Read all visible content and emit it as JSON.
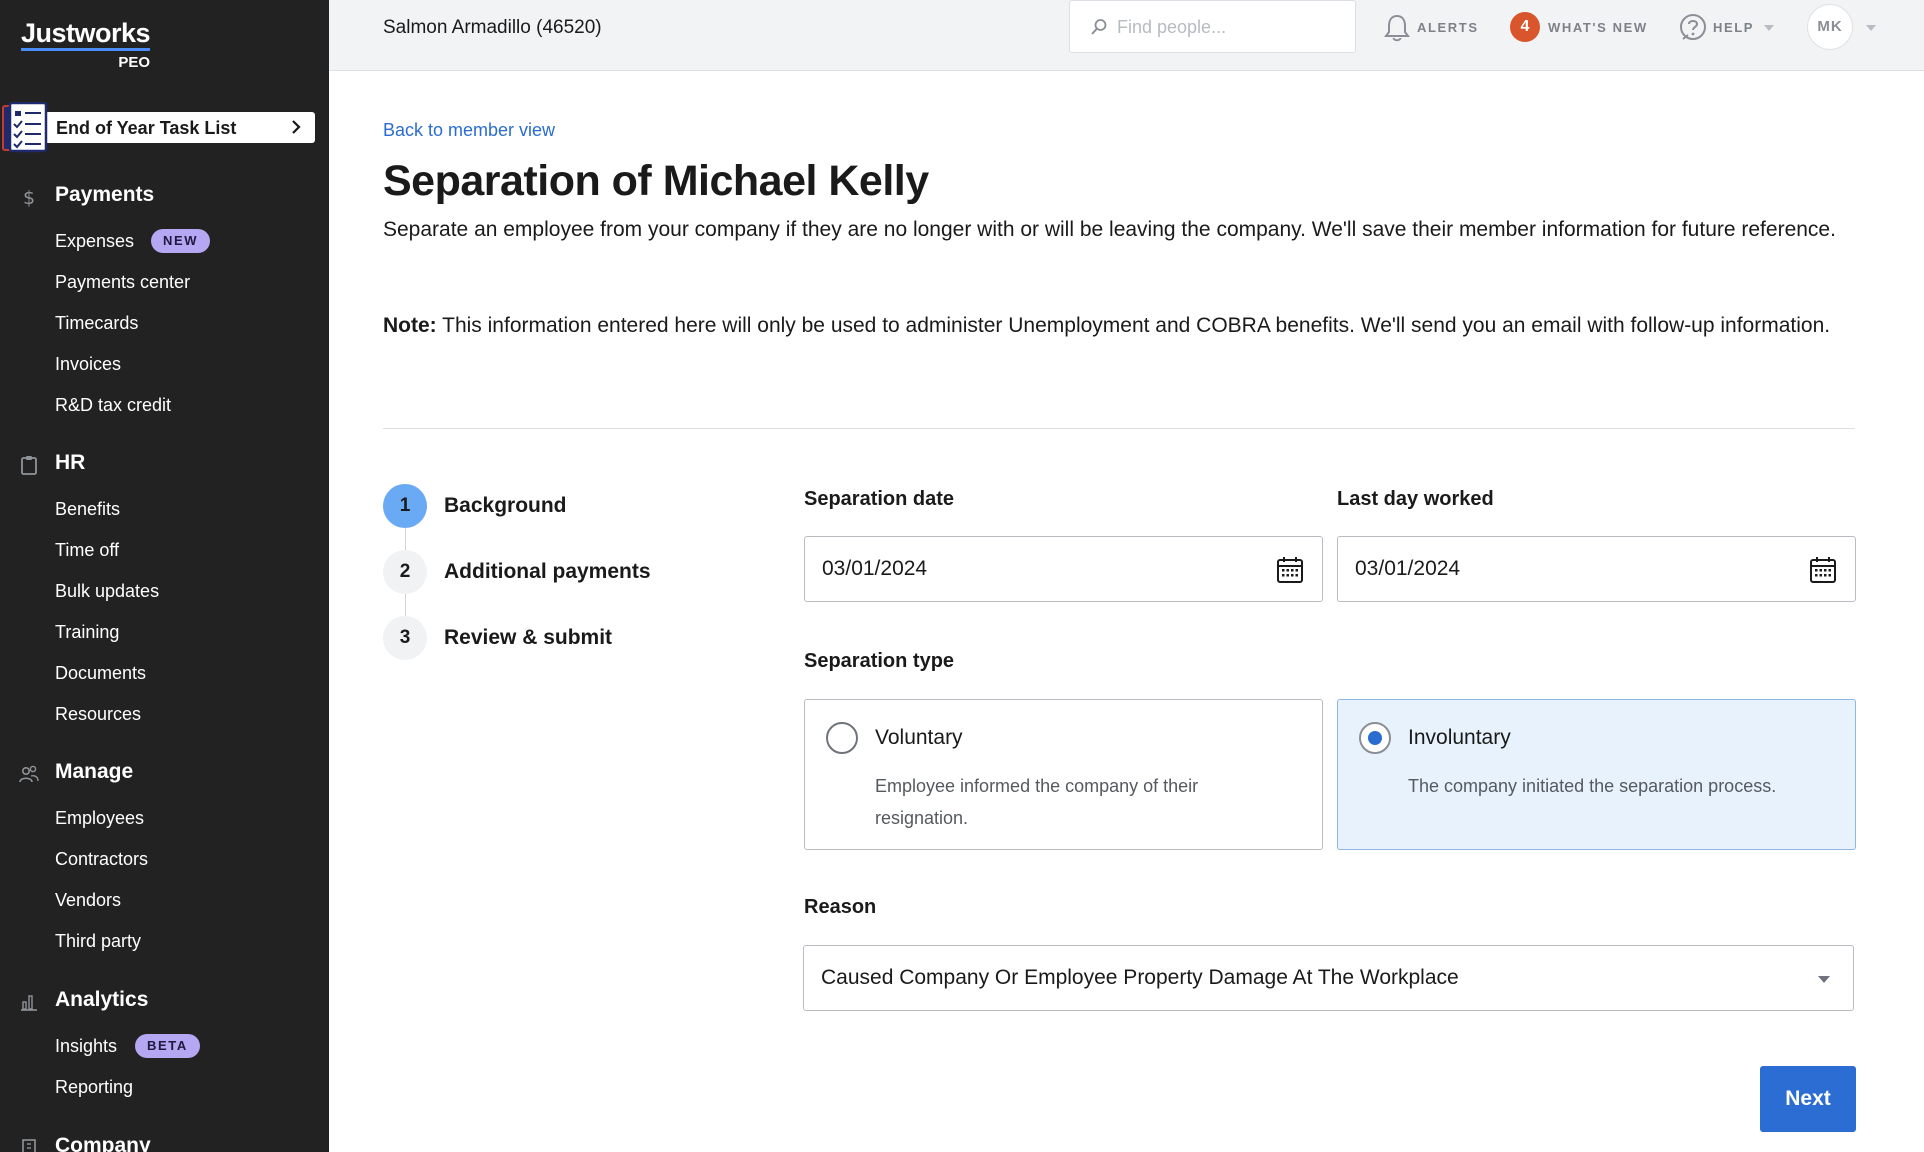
{
  "brand": {
    "logo_word": "Justworks",
    "logo_sub": "PEO"
  },
  "sidebar": {
    "task_card": {
      "label": "End of Year Task List"
    },
    "sections": [
      {
        "icon": "dollar-icon",
        "label": "Payments",
        "items": [
          {
            "label": "Expenses",
            "badge": "NEW"
          },
          {
            "label": "Payments center"
          },
          {
            "label": "Timecards"
          },
          {
            "label": "Invoices"
          },
          {
            "label": "R&D tax credit"
          }
        ]
      },
      {
        "icon": "clipboard-icon",
        "label": "HR",
        "items": [
          {
            "label": "Benefits"
          },
          {
            "label": "Time off"
          },
          {
            "label": "Bulk updates"
          },
          {
            "label": "Training"
          },
          {
            "label": "Documents"
          },
          {
            "label": "Resources"
          }
        ]
      },
      {
        "icon": "people-icon",
        "label": "Manage",
        "items": [
          {
            "label": "Employees"
          },
          {
            "label": "Contractors"
          },
          {
            "label": "Vendors"
          },
          {
            "label": "Third party"
          }
        ]
      },
      {
        "icon": "bar-chart-icon",
        "label": "Analytics",
        "items": [
          {
            "label": "Insights",
            "badge": "BETA"
          },
          {
            "label": "Reporting"
          }
        ]
      },
      {
        "icon": "building-icon",
        "label": "Company",
        "items": []
      }
    ]
  },
  "topbar": {
    "company": "Salmon Armadillo (46520)",
    "search_placeholder": "Find people...",
    "alerts_label": "ALERTS",
    "whats_new_count": "4",
    "whats_new_label": "WHAT'S NEW",
    "help_label": "HELP",
    "avatar_initials": "MK"
  },
  "page": {
    "back_link": "Back to member view",
    "title": "Separation of Michael Kelly",
    "intro": "Separate an employee from your company if they are no longer with or will be leaving the company. We'll save their member information for future reference.",
    "note_label": "Note:",
    "note_text": " This information entered here will only be used to administer Unemployment and COBRA benefits. We'll send you an email with follow-up information."
  },
  "steps": [
    {
      "number": "1",
      "label": "Background",
      "active": true
    },
    {
      "number": "2",
      "label": "Additional payments",
      "active": false
    },
    {
      "number": "3",
      "label": "Review & submit",
      "active": false
    }
  ],
  "form": {
    "separation_date": {
      "label": "Separation date",
      "value": "03/01/2024"
    },
    "last_day_worked": {
      "label": "Last day worked",
      "value": "03/01/2024"
    },
    "separation_type": {
      "label": "Separation type",
      "selected": "involuntary",
      "options": [
        {
          "id": "voluntary",
          "title": "Voluntary",
          "description": "Employee informed the company of their resignation."
        },
        {
          "id": "involuntary",
          "title": "Involuntary",
          "description": "The company initiated the separation process."
        }
      ]
    },
    "reason": {
      "label": "Reason",
      "value": "Caused Company Or Employee Property Damage At The Workplace"
    },
    "next_label": "Next"
  },
  "colors": {
    "sidebar_bg": "#222222",
    "accent_blue": "#2c6dd3",
    "step_active": "#6aa9f4",
    "badge_purple": "#b5a7f2",
    "alert_orange": "#d9552b",
    "selected_card_bg": "#e8f2fc"
  }
}
